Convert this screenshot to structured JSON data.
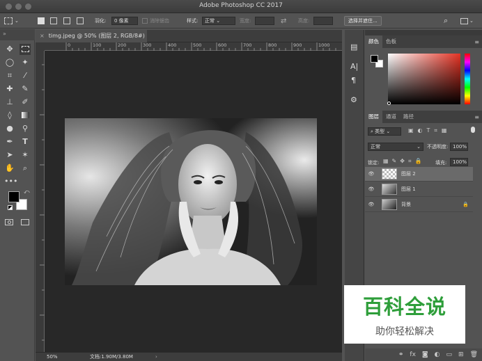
{
  "app": {
    "title": "Adobe Photoshop CC 2017"
  },
  "options": {
    "feather_label": "羽化:",
    "feather_value": "0 像素",
    "antialias_label": "消除锯齿",
    "style_label": "样式:",
    "style_value": "正常",
    "width_label": "宽度:",
    "height_label": "高度:",
    "select_mask_label": "选择并遮住..."
  },
  "document": {
    "tab_label": "timg.jpeg @ 50% (图层 2, RGB/8#) *",
    "ruler_ticks": [
      "0",
      "100",
      "200",
      "300",
      "400",
      "500",
      "600",
      "700",
      "800",
      "900",
      "1000"
    ]
  },
  "status": {
    "zoom": "50%",
    "doc_info": "文档:1.90M/3.80M"
  },
  "color_panel": {
    "tabs": [
      "颜色",
      "色板"
    ]
  },
  "layers_panel": {
    "tabs": [
      "图层",
      "通道",
      "路径"
    ],
    "filter_label": "类型",
    "blend_mode": "正常",
    "opacity_label": "不透明度:",
    "opacity_value": "100%",
    "lock_label": "锁定:",
    "fill_label": "填充:",
    "fill_value": "100%",
    "layers": [
      {
        "name": "图层 2"
      },
      {
        "name": "图层 1"
      },
      {
        "name": "背景"
      }
    ]
  },
  "watermark": {
    "title": "百科全说",
    "subtitle": "助你轻松解决"
  },
  "colors": {
    "accent_green": "#2e9e3a",
    "ui_bg": "#535353"
  }
}
